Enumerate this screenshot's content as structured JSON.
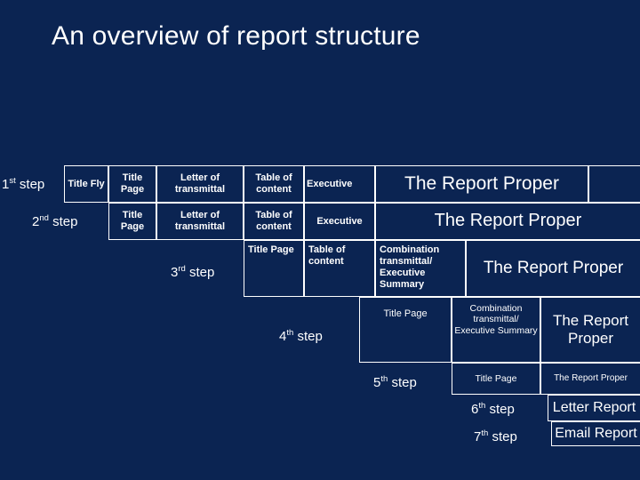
{
  "page": {
    "title": "An overview of report structure",
    "background_color": "#0b2452",
    "line_color": "#ffffff"
  },
  "steps": [
    {
      "label_prefix": "1",
      "label_sup": "st",
      "label_suffix": " step"
    },
    {
      "label_prefix": "2",
      "label_sup": "nd",
      "label_suffix": " step"
    },
    {
      "label_prefix": "3",
      "label_sup": "rd",
      "label_suffix": " step"
    },
    {
      "label_prefix": "4",
      "label_sup": "th",
      "label_suffix": " step"
    },
    {
      "label_prefix": "5",
      "label_sup": "th",
      "label_suffix": " step"
    },
    {
      "label_prefix": "6",
      "label_sup": "th",
      "label_suffix": " step"
    },
    {
      "label_prefix": "7",
      "label_sup": "th",
      "label_suffix": " step"
    }
  ],
  "row1": {
    "cells": [
      "Title Fly",
      "Title Page",
      "Letter of transmittal",
      "Table of content",
      "Executive"
    ],
    "proper": "The Report Proper"
  },
  "row2": {
    "cells": [
      "Title Page",
      "Letter of transmittal",
      "Table of content",
      "Executive"
    ],
    "proper": "The Report Proper"
  },
  "row3": {
    "cells": [
      "Title Page",
      "Table of content",
      "Combination transmittal/ Executive Summary"
    ],
    "proper": "The Report Proper"
  },
  "row4": {
    "cells": [
      "Title Page",
      "Combination transmittal/ Executive Summary"
    ],
    "proper": "The Report Proper"
  },
  "row5": {
    "cells": [
      "Title Page"
    ],
    "proper": "The Report Proper"
  },
  "row6": {
    "proper": "Letter Report"
  },
  "row7": {
    "proper": "Email Report"
  }
}
